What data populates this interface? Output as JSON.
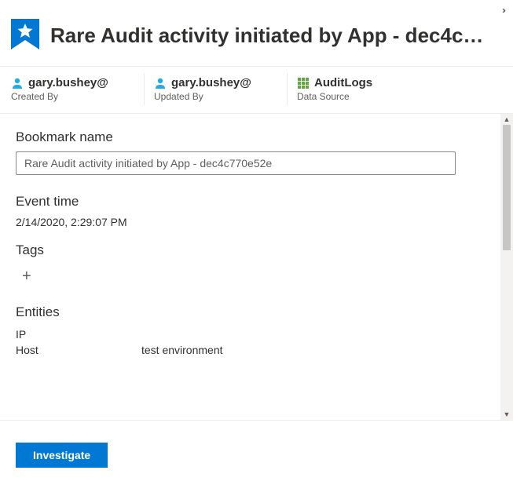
{
  "header": {
    "title": "Rare Audit activity initiated by App - dec4c…"
  },
  "meta": {
    "created_by": {
      "value": "gary.bushey@",
      "label": "Created By"
    },
    "updated_by": {
      "value": "gary.bushey@",
      "label": "Updated By"
    },
    "data_source": {
      "value": "AuditLogs",
      "label": "Data Source"
    }
  },
  "form": {
    "bookmark_name_label": "Bookmark name",
    "bookmark_name_value": "Rare Audit activity initiated by App - dec4c770e52e",
    "event_time_label": "Event time",
    "event_time_value": "2/14/2020, 2:29:07 PM",
    "tags_label": "Tags",
    "entities_label": "Entities",
    "entities": [
      {
        "key": "IP",
        "value": ""
      },
      {
        "key": "Host",
        "value": "test environment"
      }
    ]
  },
  "footer": {
    "investigate_label": "Investigate"
  }
}
